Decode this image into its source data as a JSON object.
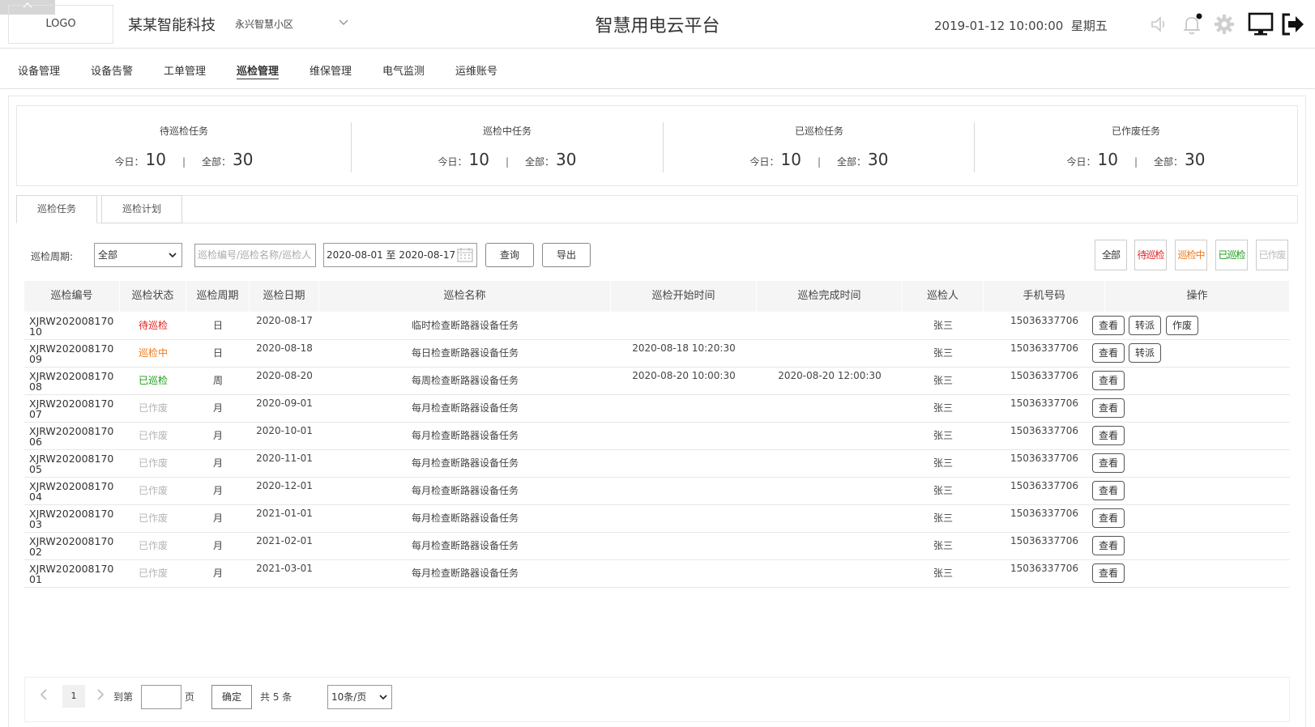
{
  "header": {
    "logo": "LOGO",
    "company": "某某智能科技",
    "community": "永兴智慧小区",
    "title": "智慧用电云平台",
    "datetime": "2019-01-12 10:00:00",
    "weekday": "星期五"
  },
  "nav": [
    "设备管理",
    "设备告警",
    "工单管理",
    "巡检管理",
    "维保管理",
    "电气监测",
    "运维账号"
  ],
  "stats": {
    "today_label": "今日：",
    "all_label": "全部：",
    "sep": "|",
    "cards": [
      {
        "title": "待巡检任务",
        "today": "10",
        "all": "30"
      },
      {
        "title": "巡检中任务",
        "today": "10",
        "all": "30"
      },
      {
        "title": "已巡检任务",
        "today": "10",
        "all": "30"
      },
      {
        "title": "已作废任务",
        "today": "10",
        "all": "30"
      }
    ]
  },
  "subtabs": [
    "巡检任务",
    "巡检计划"
  ],
  "filter": {
    "cycle_label": "巡检周期:",
    "cycle_value": "全部",
    "search_placeholder": "巡检编号/巡检名称/巡检人",
    "date_range": "2020-08-01 至 2020-08-17",
    "query": "查询",
    "export": "导出"
  },
  "status_filters": [
    "全部",
    "待巡检",
    "巡检中",
    "已巡检",
    "已作废"
  ],
  "colors": {
    "pending": "#e02020",
    "progress": "#f07818",
    "done": "#1a9a1a",
    "void": "#b5b5b5"
  },
  "table": {
    "headers": [
      "巡检编号",
      "巡检状态",
      "巡检周期",
      "巡检日期",
      "巡检名称",
      "巡检开始时间",
      "巡检完成时间",
      "巡检人",
      "手机号码",
      "操作"
    ],
    "rows": [
      {
        "code": "XJRW20200817010",
        "status": "待巡检",
        "cycle": "日",
        "date": "2020-08-17",
        "name": "临时检查断路器设备任务",
        "start": "",
        "end": "",
        "person": "张三",
        "phone": "15036337706",
        "ops": [
          "查看",
          "转派",
          "作废"
        ]
      },
      {
        "code": "XJRW20200817009",
        "status": "巡检中",
        "cycle": "日",
        "date": "2020-08-18",
        "name": "每日检查断路器设备任务",
        "start": "2020-08-18 10:20:30",
        "end": "",
        "person": "张三",
        "phone": "15036337706",
        "ops": [
          "查看",
          "转派"
        ]
      },
      {
        "code": "XJRW20200817008",
        "status": "已巡检",
        "cycle": "周",
        "date": "2020-08-20",
        "name": "每周检查断路器设备任务",
        "start": "2020-08-20 10:00:30",
        "end": "2020-08-20 12:00:30",
        "person": "张三",
        "phone": "15036337706",
        "ops": [
          "查看"
        ]
      },
      {
        "code": "XJRW20200817007",
        "status": "已作废",
        "cycle": "月",
        "date": "2020-09-01",
        "name": "每月检查断路器设备任务",
        "start": "",
        "end": "",
        "person": "张三",
        "phone": "15036337706",
        "ops": [
          "查看"
        ]
      },
      {
        "code": "XJRW20200817006",
        "status": "已作废",
        "cycle": "月",
        "date": "2020-10-01",
        "name": "每月检查断路器设备任务",
        "start": "",
        "end": "",
        "person": "张三",
        "phone": "15036337706",
        "ops": [
          "查看"
        ]
      },
      {
        "code": "XJRW20200817005",
        "status": "已作废",
        "cycle": "月",
        "date": "2020-11-01",
        "name": "每月检查断路器设备任务",
        "start": "",
        "end": "",
        "person": "张三",
        "phone": "15036337706",
        "ops": [
          "查看"
        ]
      },
      {
        "code": "XJRW20200817004",
        "status": "已作废",
        "cycle": "月",
        "date": "2020-12-01",
        "name": "每月检查断路器设备任务",
        "start": "",
        "end": "",
        "person": "张三",
        "phone": "15036337706",
        "ops": [
          "查看"
        ]
      },
      {
        "code": "XJRW20200817003",
        "status": "已作废",
        "cycle": "月",
        "date": "2021-01-01",
        "name": "每月检查断路器设备任务",
        "start": "",
        "end": "",
        "person": "张三",
        "phone": "15036337706",
        "ops": [
          "查看"
        ]
      },
      {
        "code": "XJRW20200817002",
        "status": "已作废",
        "cycle": "月",
        "date": "2021-02-01",
        "name": "每月检查断路器设备任务",
        "start": "",
        "end": "",
        "person": "张三",
        "phone": "15036337706",
        "ops": [
          "查看"
        ]
      },
      {
        "code": "XJRW20200817001",
        "status": "已作废",
        "cycle": "月",
        "date": "2021-03-01",
        "name": "每月检查断路器设备任务",
        "start": "",
        "end": "",
        "person": "张三",
        "phone": "15036337706",
        "ops": [
          "查看"
        ]
      }
    ]
  },
  "pagination": {
    "current": "1",
    "goto_label": "到第",
    "page_label": "页",
    "confirm": "确定",
    "total": "共 5 条",
    "page_size": "10条/页"
  }
}
